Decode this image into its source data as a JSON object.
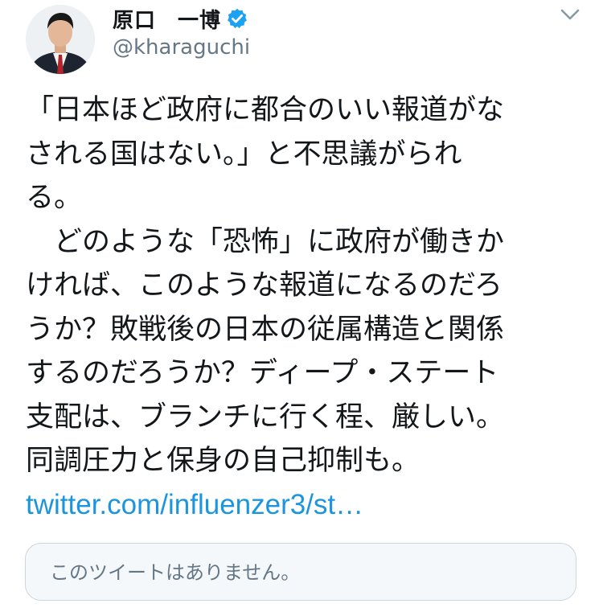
{
  "author": {
    "display_name": "原口　一博",
    "handle": "@kharaguchi",
    "verified": true,
    "avatar_icon": "profile-photo"
  },
  "menu": {
    "icon": "chevron-down-icon"
  },
  "tweet": {
    "lines": [
      "「日本ほど政府に都合のいい報道がな",
      "される国はない。」と不思議がられ",
      "る。",
      "　どのような「恐怖」に政府が働きか",
      "ければ、このような報道になるのだろ",
      "うか？敗戦後の日本の従属構造と関係",
      "するのだろうか？ディープ・ステート",
      "支配は、ブランチに行く程、厳しい。",
      "同調圧力と保身の自己抑制も。"
    ],
    "link_text": "twitter.com/influenzer3/st…"
  },
  "quoted_tweet": {
    "unavailable_text": "このツイートはありません。"
  },
  "colors": {
    "text": "#14171a",
    "secondary": "#657786",
    "link": "#1b95e0",
    "verified": "#1da1f2",
    "quote_bg": "#f5f8fa",
    "quote_border": "#ccd6dd"
  }
}
